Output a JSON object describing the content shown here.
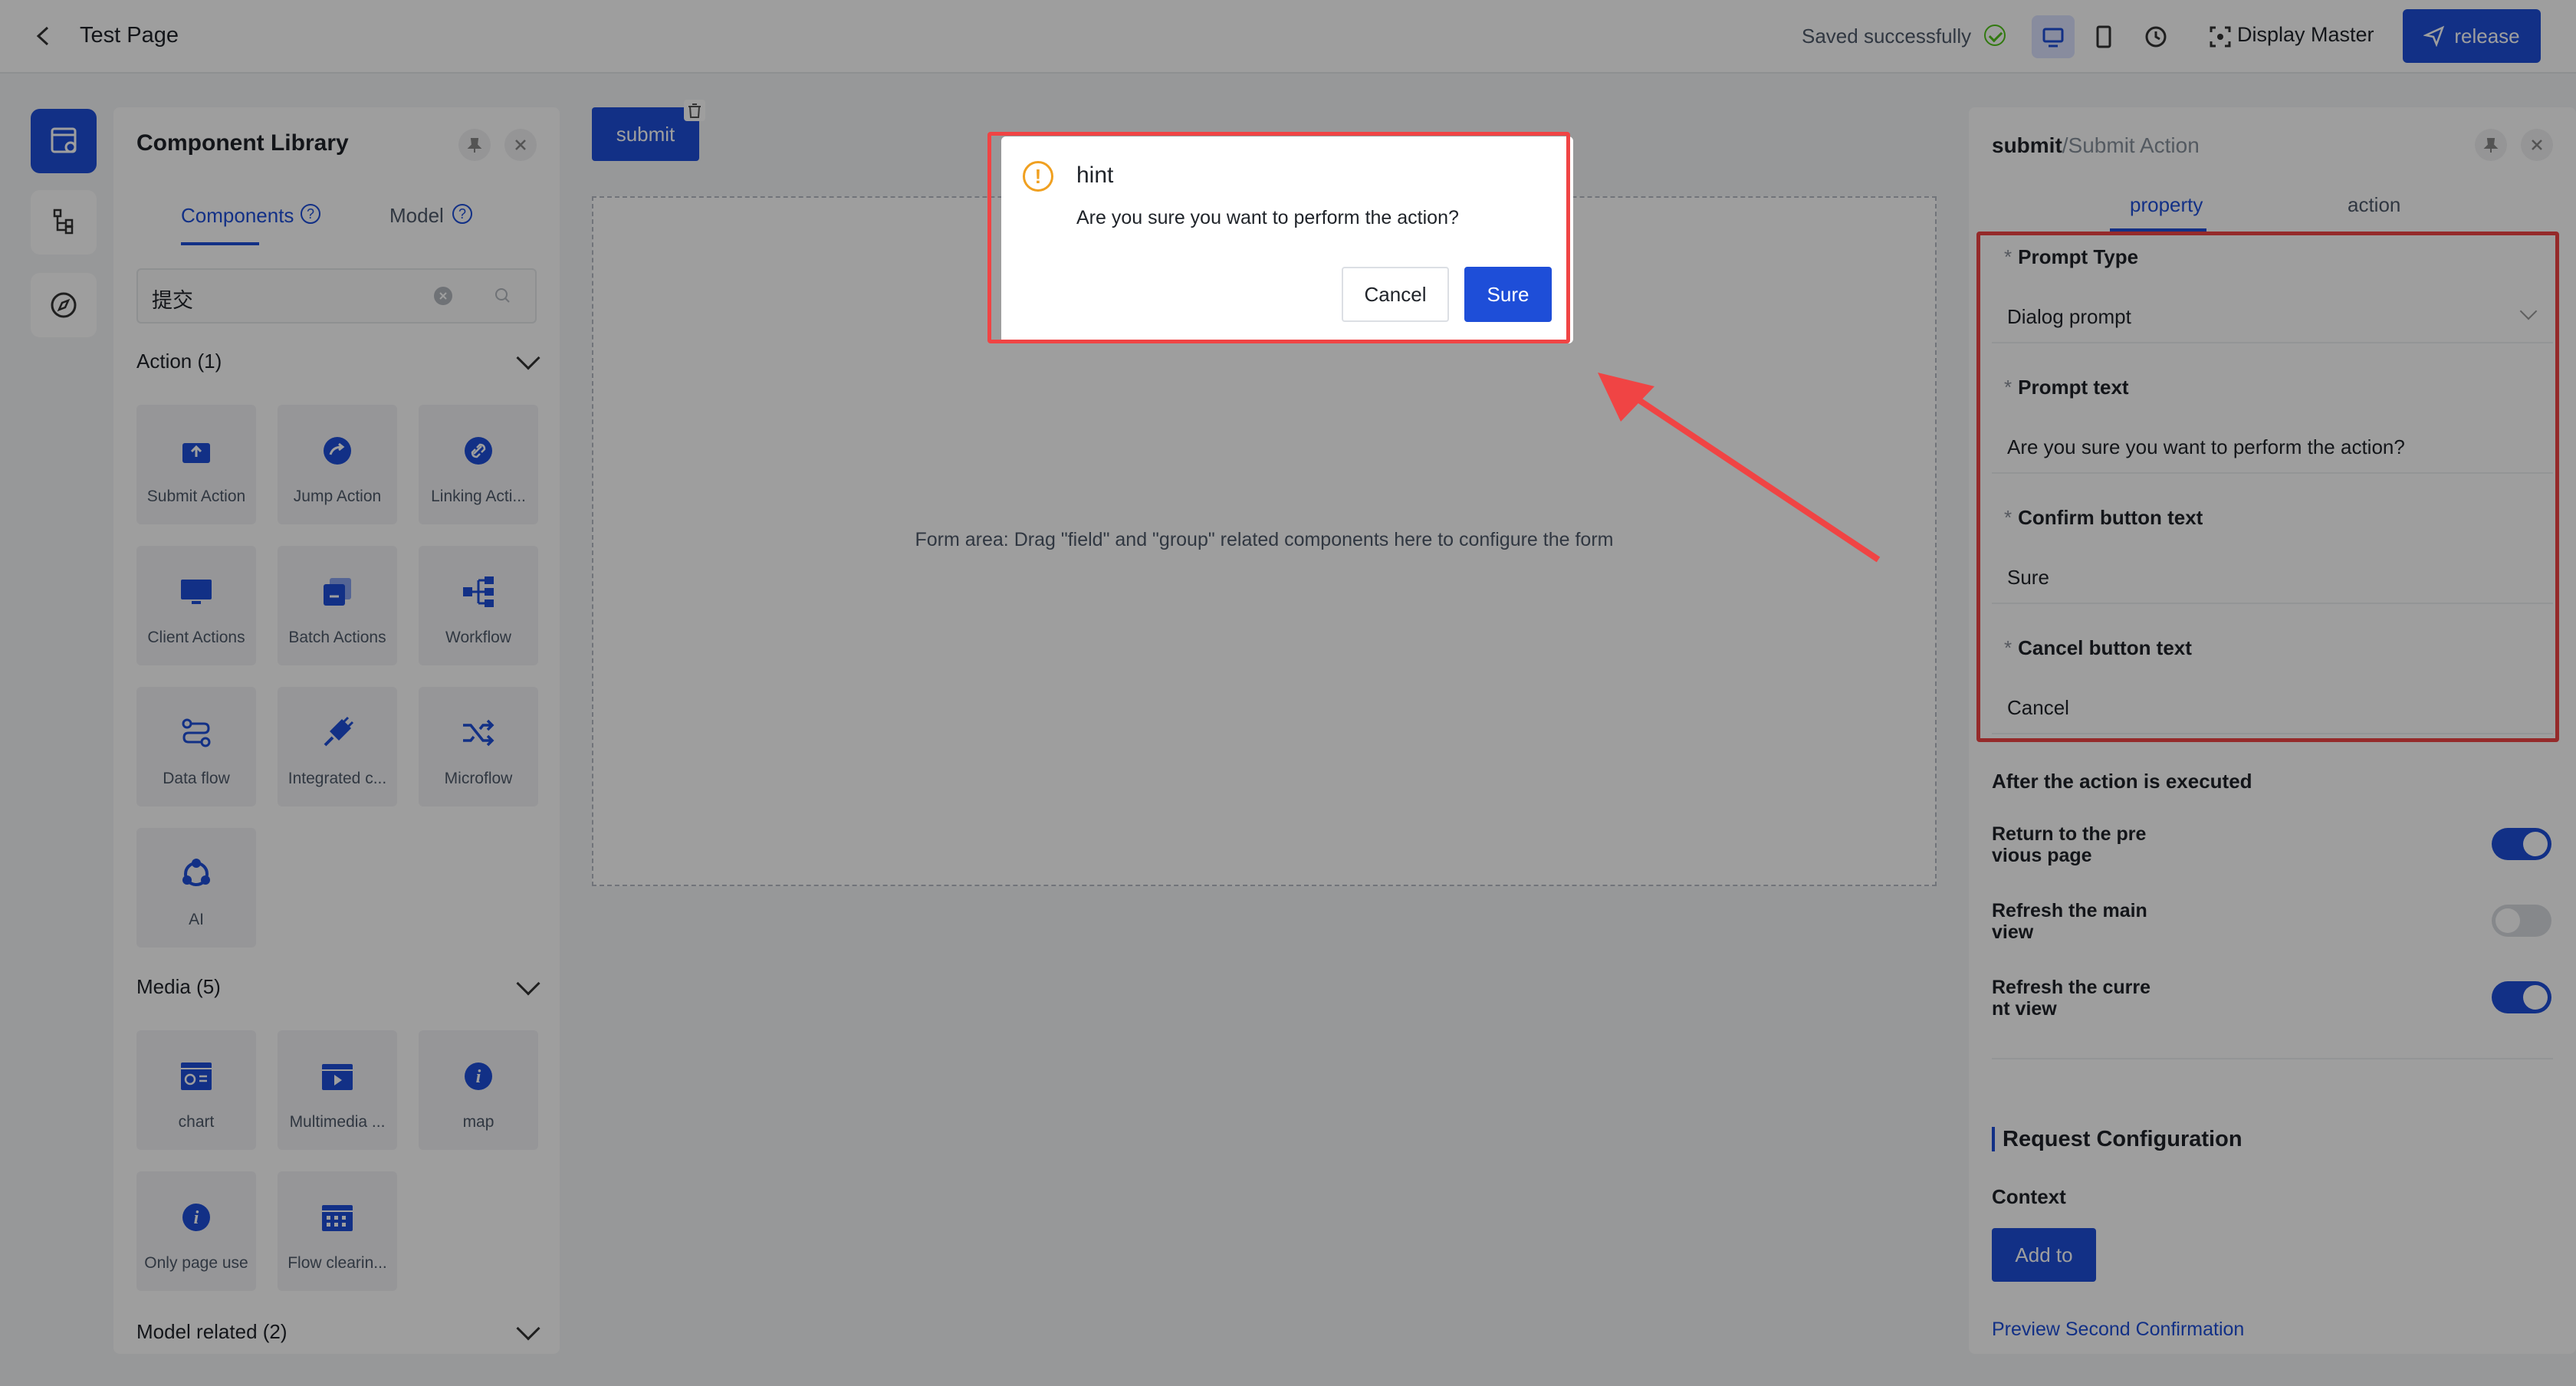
{
  "header": {
    "title": "Test Page",
    "saved_text": "Saved successfully",
    "display_master": "Display Master",
    "release": "release"
  },
  "library": {
    "title": "Component Library",
    "tabs": [
      "Components",
      "Model"
    ],
    "search_value": "提交",
    "sections": [
      {
        "label": "Action (1)",
        "items": [
          "Submit Action",
          "Jump Action",
          "Linking Acti...",
          "Client Actions",
          "Batch Actions",
          "Workflow",
          "Data flow",
          "Integrated c...",
          "Microflow",
          "AI"
        ]
      },
      {
        "label": "Media (5)",
        "items": [
          "chart",
          "Multimedia ...",
          "map",
          "Only page use",
          "Flow clearin..."
        ]
      },
      {
        "label": "Model related (2)",
        "items": []
      }
    ]
  },
  "canvas": {
    "submit_label": "submit",
    "form_hint": "Form area: Drag \"field\" and \"group\" related components here to configure the form"
  },
  "dialog": {
    "title": "hint",
    "message": "Are you sure you want to perform the action?",
    "cancel": "Cancel",
    "sure": "Sure"
  },
  "panel": {
    "title_main": "submit",
    "title_sub": "/Submit Action",
    "tabs": [
      "property",
      "action"
    ],
    "fields": [
      {
        "label": "Prompt Type",
        "value": "Dialog prompt"
      },
      {
        "label": "Prompt text",
        "value": "Are you sure you want to perform the action?"
      },
      {
        "label": "Confirm button text",
        "value": "Sure"
      },
      {
        "label": "Cancel button text",
        "value": "Cancel"
      }
    ],
    "after_title": "After the action is executed",
    "toggles": [
      {
        "line1": "Return to the pre",
        "line2": "vious page",
        "on": true
      },
      {
        "line1": "Refresh the main",
        "line2": "view",
        "on": false
      },
      {
        "line1": "Refresh the curre",
        "line2": "nt view",
        "on": true
      }
    ],
    "request_title": "Request Configuration",
    "context_label": "Context",
    "add_to": "Add to",
    "preview": "Preview Second Confirmation"
  },
  "colors": {
    "accent": "#1e4ed8",
    "highlight": "#f04444",
    "warning": "#f0a020",
    "success": "#52c41a"
  }
}
